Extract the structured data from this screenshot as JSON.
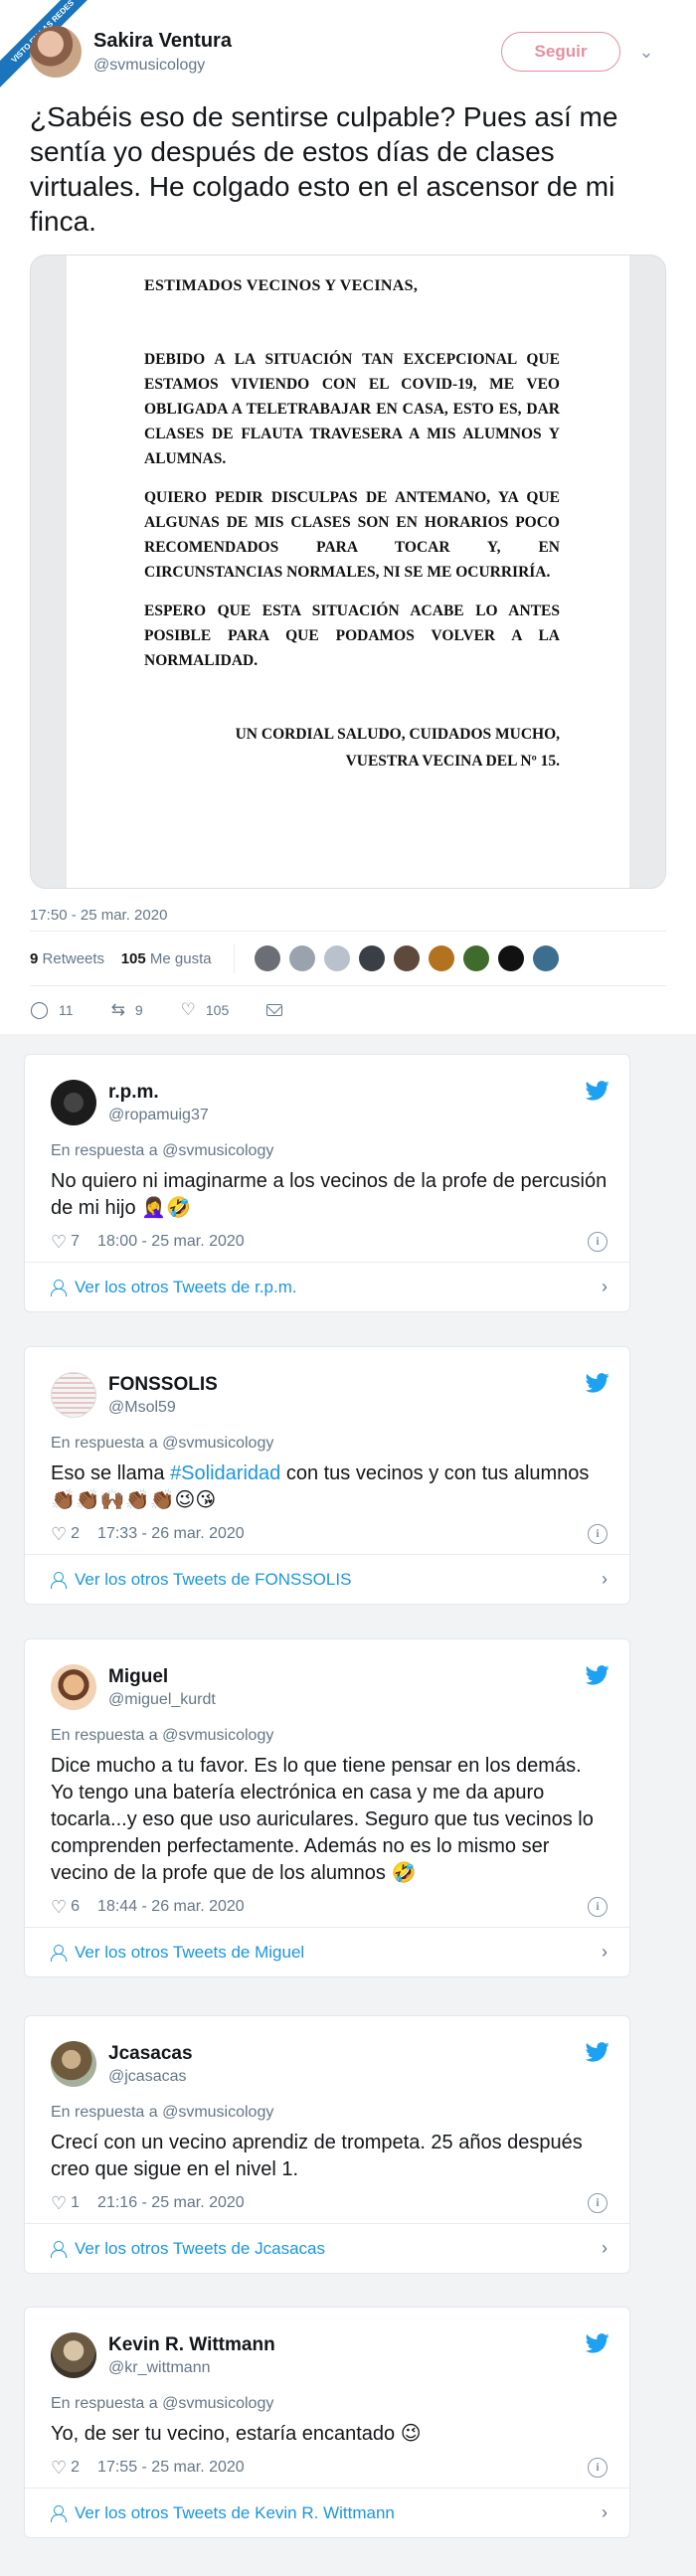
{
  "badge": {
    "text": "VISTO EN LAS REDES"
  },
  "main": {
    "author_name": "Sakira Ventura",
    "author_handle": "@svmusicology",
    "follow_label": "Seguir",
    "menu_icon": "chevron-down-icon",
    "text": "¿Sabéis eso de sentirse culpable? Pues así me sentía yo después de estos días de clases virtuales. He colgado esto en el ascensor de mi finca.",
    "letter": {
      "heading": "ESTIMADOS VECINOS Y VECINAS,",
      "p1": "DEBIDO A LA SITUACIÓN TAN EXCEPCIONAL QUE ESTAMOS VIVIENDO CON EL COVID-19, ME VEO OBLIGADA A TELETRABAJAR EN CASA, ESTO ES, DAR CLASES DE FLAUTA TRAVESERA A MIS ALUMNOS Y ALUMNAS.",
      "p2": "QUIERO PEDIR DISCULPAS DE ANTEMANO, YA QUE ALGUNAS DE MIS CLASES SON EN HORARIOS POCO RECOMENDADOS PARA TOCAR Y, EN CIRCUNSTANCIAS NORMALES, NI SE ME OCURRIRÍA.",
      "p3": "ESPERO QUE ESTA SITUACIÓN ACABE LO ANTES POSIBLE PARA QUE PODAMOS VOLVER A LA NORMALIDAD.",
      "closing_1": "UN CORDIAL SALUDO, CUIDADOS MUCHO,",
      "closing_2": "VUESTRA VECINA DEL Nº 15."
    },
    "timestamp": "17:50 - 25 mar. 2020",
    "retweets_count": "9",
    "retweets_label": "Retweets",
    "likes_count": "105",
    "likes_label": "Me gusta",
    "actions": {
      "replies": "11",
      "retweets": "9",
      "likes": "105"
    }
  },
  "replies": [
    {
      "name": "r.p.m.",
      "handle": "@ropamuig37",
      "reply_to": "En respuesta a @svmusicology",
      "text": "No quiero ni imaginarme a los vecinos de la profe de percusión de mi hijo 🤦‍♀️🤣",
      "likes": "7",
      "time": "18:00 - 25 mar. 2020",
      "footer": "Ver los otros Tweets de r.p.m."
    },
    {
      "name": "FONSSOLIS",
      "handle": "@Msol59",
      "reply_to": "En respuesta a @svmusicology",
      "text_pre": "Eso se llama ",
      "hashtag": "#Solidaridad",
      "text_post": " con tus vecinos y con tus alumnos👏🏾👏🏾🙌🏾👏🏾👏🏾😉😘",
      "likes": "2",
      "time": "17:33 - 26 mar. 2020",
      "footer": "Ver los otros Tweets de FONSSOLIS"
    },
    {
      "name": "Miguel",
      "handle": "@miguel_kurdt",
      "reply_to": "En respuesta a @svmusicology",
      "text": "Dice mucho a tu favor. Es lo que tiene pensar en los demás. Yo tengo una batería electrónica en casa y me da apuro tocarla...y eso que uso auriculares. Seguro que tus vecinos lo comprenden perfectamente. Además no es lo mismo ser vecino de la profe que de los alumnos 🤣",
      "likes": "6",
      "time": "18:44 - 26 mar. 2020",
      "footer": "Ver los otros Tweets de Miguel"
    },
    {
      "name": "Jcasacas",
      "handle": "@jcasacas",
      "reply_to": "En respuesta a @svmusicology",
      "text": "Crecí con un vecino aprendiz de trompeta. 25 años después creo que sigue en el nivel 1.",
      "likes": "1",
      "time": "21:16 - 25 mar. 2020",
      "footer": "Ver los otros Tweets de Jcasacas"
    },
    {
      "name": "Kevin R. Wittmann",
      "handle": "@kr_wittmann",
      "reply_to": "En respuesta a @svmusicology",
      "text": "Yo, de ser tu vecino, estaría encantado 😉",
      "likes": "2",
      "time": "17:55 - 25 mar. 2020",
      "footer": "Ver los otros Tweets de Kevin R. Wittmann"
    }
  ],
  "colors": {
    "link": "#1b95e0",
    "follow": "#e4909f",
    "muted": "#657786"
  }
}
